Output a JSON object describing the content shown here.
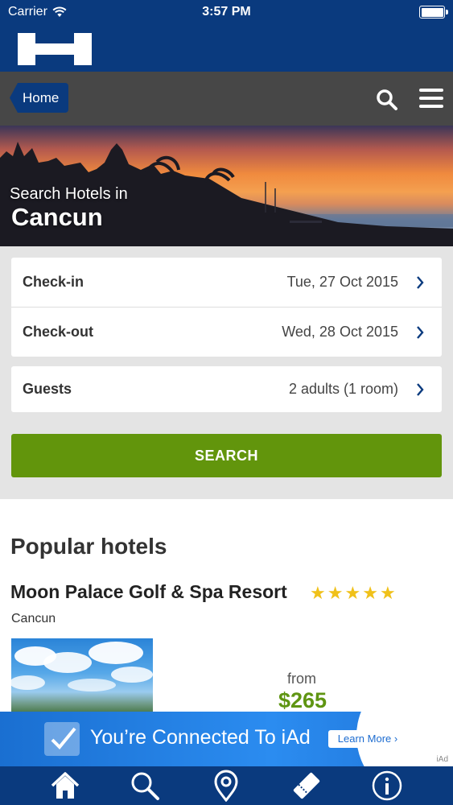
{
  "status_bar": {
    "carrier": "Carrier",
    "time": "3:57 PM"
  },
  "nav": {
    "home_label": "Home"
  },
  "hero": {
    "subtitle": "Search Hotels in",
    "city": "Cancun"
  },
  "form": {
    "checkin": {
      "label": "Check-in",
      "value": "Tue, 27 Oct 2015"
    },
    "checkout": {
      "label": "Check-out",
      "value": "Wed, 28 Oct 2015"
    },
    "guests": {
      "label": "Guests",
      "value": "2 adults (1 room)"
    },
    "search_label": "SEARCH"
  },
  "popular": {
    "title": "Popular hotels",
    "hotels": [
      {
        "name": "Moon Palace Golf & Spa Resort",
        "stars": 5,
        "city": "Cancun",
        "from_label": "from",
        "price": "$265"
      }
    ]
  },
  "ad": {
    "text": "You’re Connected To iAd",
    "button": "Learn More ›",
    "tag": "iAd"
  },
  "colors": {
    "brand_blue": "#0a3a7e",
    "nav_gray": "#474747",
    "search_green": "#62950c",
    "price_green": "#5f9512",
    "star_yellow": "#f0c11a"
  },
  "tabs": [
    {
      "icon": "home-icon"
    },
    {
      "icon": "search-icon"
    },
    {
      "icon": "map-pin-icon"
    },
    {
      "icon": "ticket-icon"
    },
    {
      "icon": "info-icon"
    }
  ]
}
